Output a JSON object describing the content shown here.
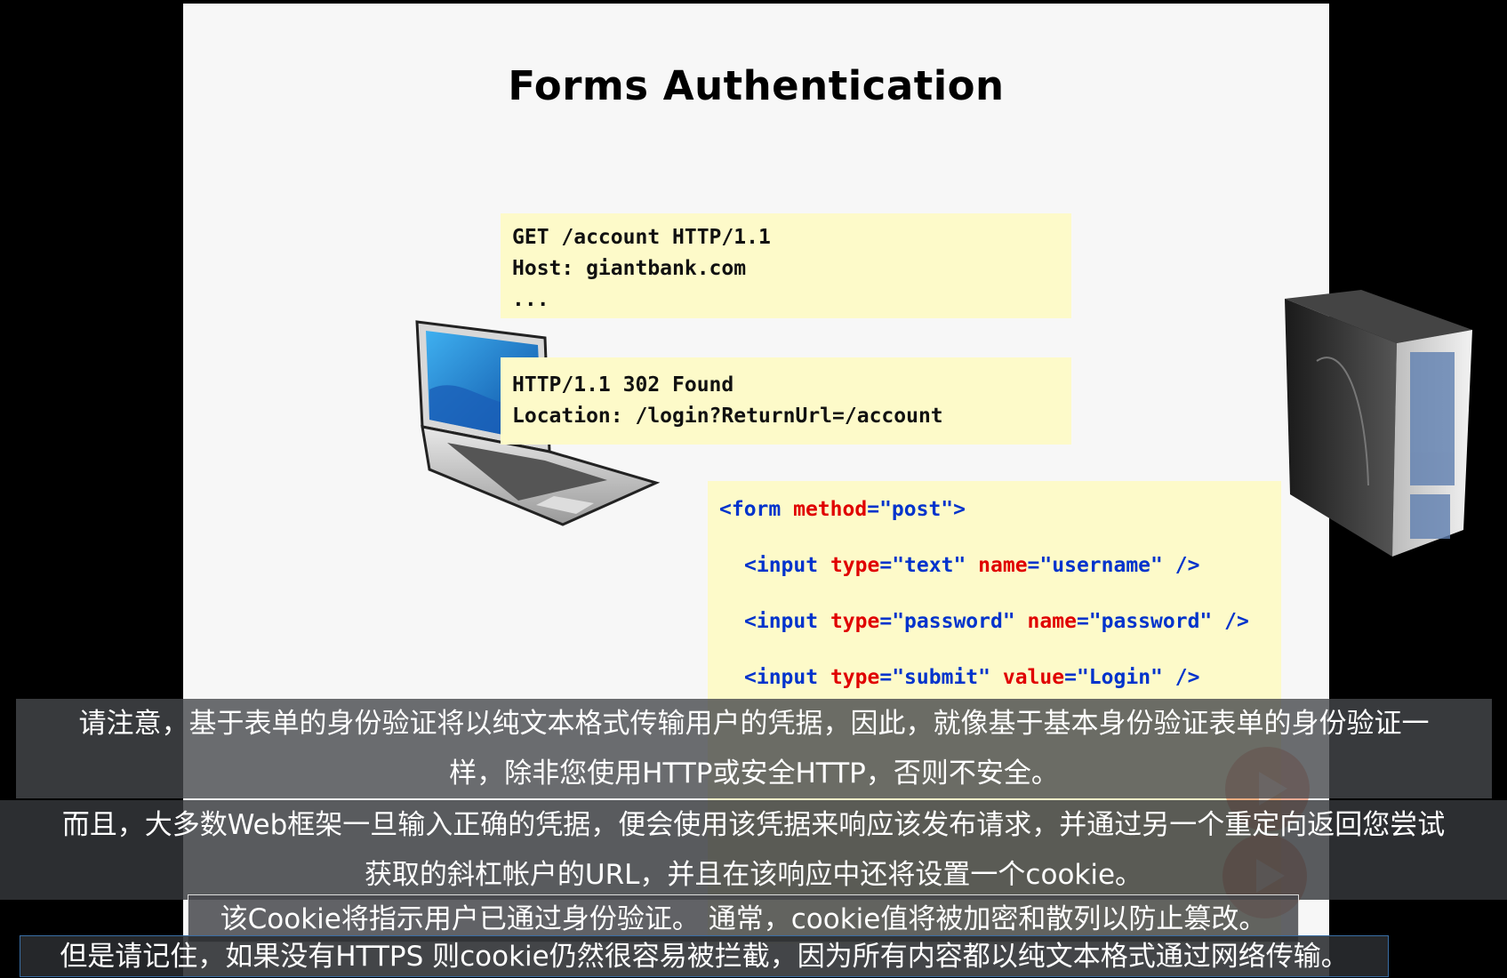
{
  "slide": {
    "title": "Forms Authentication",
    "request": {
      "lines": [
        "GET /account HTTP/1.1",
        "Host: giantbank.com",
        "..."
      ]
    },
    "response": {
      "lines": [
        "HTTP/1.1 302 Found",
        "Location: /login?ReturnUrl=/account"
      ]
    },
    "form_code": {
      "form_open": {
        "tag": "<form",
        "attr": "method",
        "val": "\"post\"",
        "close": ">"
      },
      "input1": {
        "tag": "<input",
        "a1": "type",
        "v1": "\"text\"",
        "a2": "name",
        "v2": "\"username\"",
        "close": "/>"
      },
      "input2": {
        "tag": "<input",
        "a1": "type",
        "v1": "\"password\"",
        "a2": "name",
        "v2": "\"password\"",
        "close": "/>"
      },
      "input3": {
        "tag": "<input",
        "a1": "type",
        "v1": "\"submit\"",
        "a2": "value",
        "v2": "\"Login\"",
        "close": "/>"
      },
      "eq": "="
    },
    "images": [
      "laptop-icon",
      "server-icon"
    ]
  },
  "subtitles": {
    "block1": [
      "请注意，基于表单的身份验证将以纯文本格式传输用户的凭据，因此，就像基于基本身份验证表单的身份验证一",
      "样，除非您使用HTTP或安全HTTP，否则不安全。"
    ],
    "block2": [
      "而且，大多数Web框架一旦输入正确的凭据，便会使用该凭据来响应该发布请求，并通过另一个重定向返回您尝试",
      "获取的斜杠帐户的URL，并且在该响应中还将设置一个cookie。"
    ],
    "block3": "该Cookie将指示用户已通过身份验证。 通常，cookie值将被加密和散列以防止篡改。",
    "block4": "但是请记住，如果没有HTTPS 则cookie仍然很容易被拦截，因为所有内容都以纯文本格式通过网络传输。"
  },
  "colors": {
    "code_box_bg": "#fdfac9",
    "tag_color": "#0033cc",
    "attr_color": "#e00000",
    "subtitle_bg": "#46484c"
  }
}
